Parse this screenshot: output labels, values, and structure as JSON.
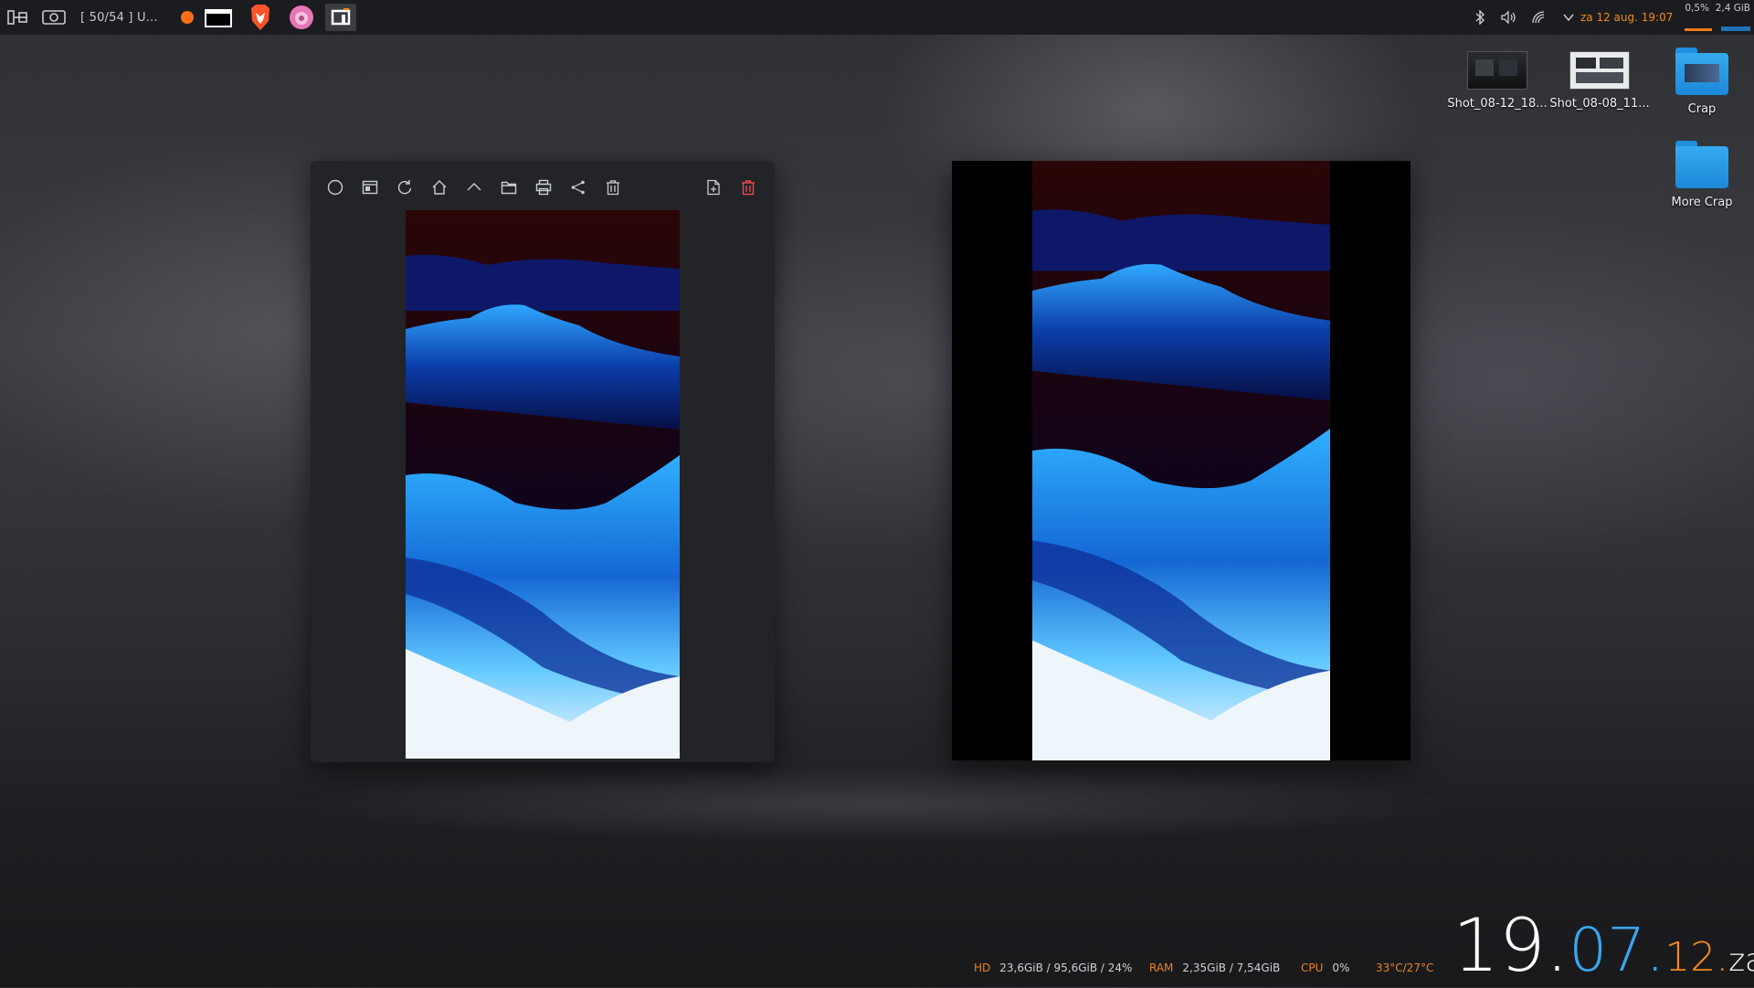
{
  "panel": {
    "task_text": "[ 50/54 ] U...",
    "date_time": "za 12 aug. 19:07",
    "cpu_percent": "0,5%",
    "ram_used": "2,4 GiB",
    "tray_icons": [
      "bluetooth-icon",
      "volume-icon",
      "network-icon",
      "expand-tray-icon"
    ]
  },
  "desktop_icons": [
    {
      "label": "Shot_08-12_18...",
      "type": "image"
    },
    {
      "label": "Shot_08-08_11...",
      "type": "image"
    },
    {
      "label": "Crap",
      "type": "folder"
    },
    {
      "label": "More Crap",
      "type": "folder"
    }
  ],
  "viewer": {
    "toolbar": [
      "circle-icon",
      "panel-icon",
      "rotate-icon",
      "home-icon",
      "up-icon",
      "folder-icon",
      "print-icon",
      "share-icon",
      "trash-icon",
      "export-icon",
      "delete-icon"
    ]
  },
  "conky": {
    "hd_label": "HD",
    "hd_value": "23,6GiB / 95,6GiB / 24%",
    "ram_label": "RAM",
    "ram_value": "2,35GiB / 7,54GiB",
    "cpu_label": "CPU",
    "cpu_value": "0%",
    "temp_value": "33°C/27°C",
    "clock_hour": "19",
    "clock_day": "07",
    "clock_month": "12",
    "clock_weekday": "za",
    "clock_dot": "."
  },
  "colors": {
    "accent_orange": "#f28a1a",
    "accent_blue": "#3aa7ee",
    "panel_bg": "#1b1c1f"
  }
}
